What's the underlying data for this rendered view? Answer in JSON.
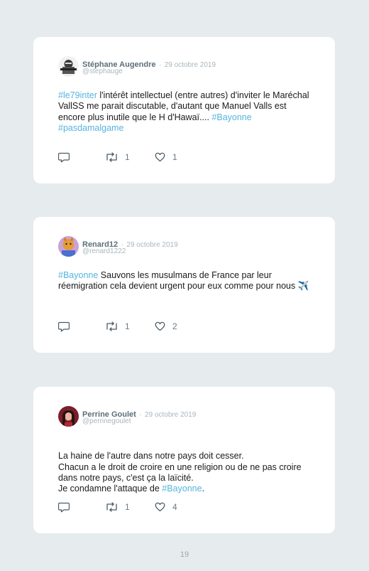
{
  "colors": {
    "background": "#e6ecee",
    "card": "#ffffff",
    "hashtag": "#55b4de",
    "muted": "#a9b6bd",
    "name": "#5d6f79"
  },
  "icons": {
    "reply": "speech-bubble-icon",
    "retweet": "retweet-arrows-icon",
    "like": "heart-icon"
  },
  "tweets": [
    {
      "name": "Stéphane Augendre",
      "date": "29 octobre 2019",
      "handle": "@stephauge",
      "text_parts": [
        {
          "text": "#le79inter",
          "tag": true
        },
        {
          "text": " l'intérêt intellectuel (entre autres) d'inviter le Maréchal VallSS me parait discutable, d'autant que Manuel Valls est encore plus inutile que le H d'Hawaï.... ",
          "tag": false
        },
        {
          "text": "#Bayonne",
          "tag": true
        },
        {
          "text": " ",
          "tag": false
        },
        {
          "text": "#pasdamalgame",
          "tag": true
        }
      ],
      "retweets": "1",
      "likes": "1"
    },
    {
      "name": "Renard12",
      "date": "29 octobre 2019",
      "handle": "@renard1222",
      "text_parts": [
        {
          "text": "#Bayonne",
          "tag": true
        },
        {
          "text": " Sauvons les musulmans de France par leur réemigration cela devient urgent pour eux comme pour nous ✈️",
          "tag": false
        }
      ],
      "retweets": "1",
      "likes": "2"
    },
    {
      "name": "Perrine Goulet",
      "date": "29 octobre 2019",
      "handle": "@perrinegoulet",
      "text_parts": [
        {
          "text": "La haine de l'autre dans notre pays doit cesser.\nChacun a le droit de croire en une religion ou de ne pas croire dans notre pays, c'est ça la laïcité.\nJe condamne l'attaque de ",
          "tag": false
        },
        {
          "text": "#Bayonne",
          "tag": true
        },
        {
          "text": ".",
          "tag": false
        }
      ],
      "retweets": "1",
      "likes": "4"
    }
  ],
  "footer": {
    "separator": "·",
    "page_number": "19"
  }
}
